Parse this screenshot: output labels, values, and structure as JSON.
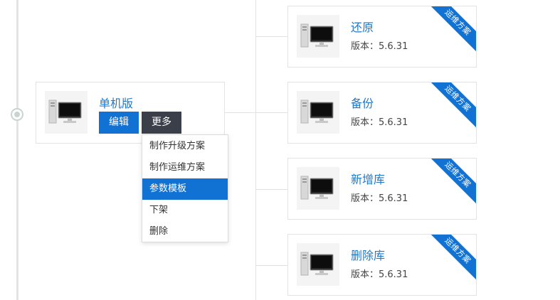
{
  "main_card": {
    "title": "单机版",
    "edit_label": "编辑",
    "more_label": "更多"
  },
  "dropdown": {
    "items": [
      "制作升级方案",
      "制作运维方案",
      "参数模板",
      "下架",
      "删除"
    ],
    "active_index": 2
  },
  "cards": [
    {
      "title": "还原",
      "version": "版本：5.6.31",
      "ribbon": "运维方案"
    },
    {
      "title": "备份",
      "version": "版本：5.6.31",
      "ribbon": "运维方案"
    },
    {
      "title": "新增库",
      "version": "版本：5.6.31",
      "ribbon": "运维方案"
    },
    {
      "title": "删除库",
      "version": "版本：5.6.31",
      "ribbon": "运维方案"
    }
  ],
  "colors": {
    "accent": "#1272d4",
    "dark_button": "#3a3f4a",
    "title_link": "#1f78c8"
  }
}
